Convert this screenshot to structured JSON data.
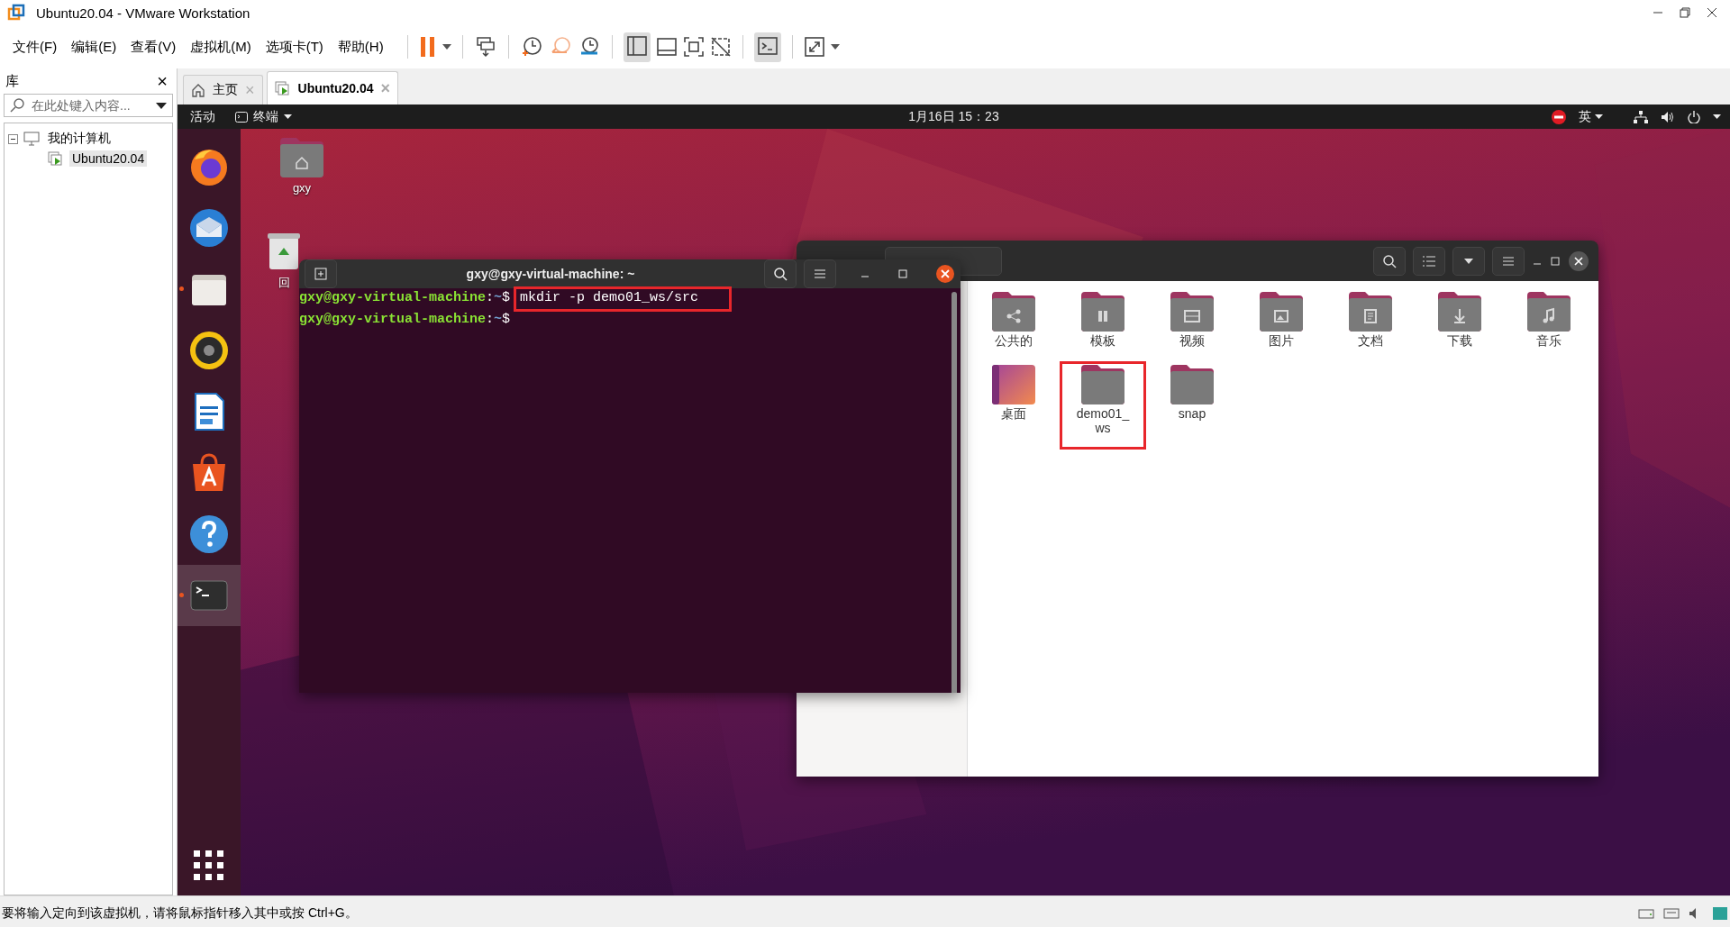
{
  "window": {
    "title": "Ubuntu20.04 - VMware Workstation"
  },
  "menu": [
    "文件(F)",
    "编辑(E)",
    "查看(V)",
    "虚拟机(M)",
    "选项卡(T)",
    "帮助(H)"
  ],
  "library": {
    "title": "库",
    "close": "×",
    "search": {
      "placeholder": "在此处键入内容..."
    },
    "tree": [
      {
        "label": "我的计算机",
        "expanded": true,
        "children": [
          {
            "label": "Ubuntu20.04",
            "selected": true
          }
        ]
      }
    ]
  },
  "tabs": [
    {
      "label": "主页",
      "close": "×",
      "selected": false
    },
    {
      "label": "Ubuntu20.04",
      "close": "×",
      "selected": true
    }
  ],
  "ubuntu": {
    "activities": "活动",
    "app_menu": "终端",
    "clock": "1月16日  15：23",
    "input_method": "英"
  },
  "dock": [
    {
      "kind": "firefox",
      "running": false,
      "selected": false
    },
    {
      "kind": "mail",
      "running": false,
      "selected": false
    },
    {
      "kind": "files",
      "running": true,
      "selected": false
    },
    {
      "kind": "speaker",
      "running": false,
      "selected": false
    },
    {
      "kind": "writer",
      "running": false,
      "selected": false
    },
    {
      "kind": "software",
      "running": false,
      "selected": false
    },
    {
      "kind": "help",
      "running": false,
      "selected": false
    },
    {
      "kind": "terminal",
      "running": true,
      "selected": true
    }
  ],
  "desktop_icons": [
    {
      "label": "gxy",
      "kind": "home"
    },
    {
      "label": "回",
      "kind": "trash"
    }
  ],
  "terminal": {
    "title": "gxy@gxy-virtual-machine: ~",
    "lines": [
      {
        "user": "gxy@gxy-virtual-machine",
        "sep": ":",
        "path": "~",
        "sign": "$",
        "command": "mkdir -p demo01_ws/src",
        "highlighted": true
      },
      {
        "user": "gxy@gxy-virtual-machine",
        "sep": ":",
        "path": "~",
        "sign": "$"
      }
    ]
  },
  "files": {
    "items": [
      {
        "label": "公共的",
        "kind": "share",
        "highlighted": false
      },
      {
        "label": "模板",
        "kind": "template",
        "highlighted": false
      },
      {
        "label": "视频",
        "kind": "video",
        "highlighted": false
      },
      {
        "label": "图片",
        "highlighted": false
      },
      {
        "label": "文档",
        "kind": "document",
        "highlighted": false
      },
      {
        "label": "下载",
        "kind": "download",
        "highlighted": false
      },
      {
        "label": "音乐",
        "kind": "music",
        "highlighted": false
      },
      {
        "label": "桌面",
        "kind": "desktop",
        "highlighted": false
      },
      {
        "label": "demo01_ws",
        "kind": "plain",
        "highlighted": true
      },
      {
        "label": "snap",
        "kind": "plain",
        "highlighted": false
      }
    ]
  },
  "status_bar": {
    "text": "要将输入定向到该虚拟机，请将鼠标指针移入其中或按 Ctrl+G。"
  }
}
